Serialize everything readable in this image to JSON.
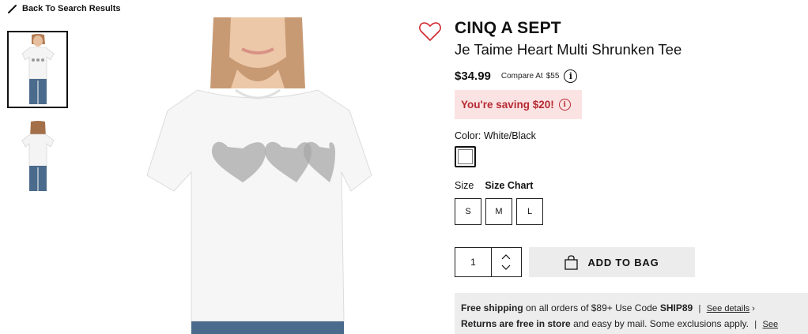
{
  "nav": {
    "back_label": "Back To Search Results"
  },
  "product": {
    "brand": "CINQ A SEPT",
    "name": "Je Taime Heart Multi Shrunken Tee",
    "price": "$34.99",
    "compare_label": "Compare At",
    "compare_value": "$55",
    "saving": "You're saving $20!"
  },
  "color": {
    "label": "Color:",
    "value": "White/Black"
  },
  "size": {
    "label": "Size",
    "chart_label": "Size Chart",
    "options": [
      "S",
      "M",
      "L"
    ]
  },
  "cart": {
    "quantity": "1",
    "add_label": "ADD TO BAG"
  },
  "shipping": {
    "line1_bold": "Free shipping",
    "line1_text": "on all orders of $89+ Use Code",
    "line1_code": "SHIP89",
    "line2_bold": "Returns are free in store",
    "line2_text": "and easy by mail. Some exclusions apply.",
    "details_label": "See details"
  },
  "colors": {
    "accent": "#d0282f",
    "saving_bg": "#fbe3e3",
    "saving_text": "#b52a32",
    "button_bg": "#ececec"
  },
  "icons": {
    "back": "pencil-icon",
    "wishlist": "heart-outline-icon",
    "info": "info-icon",
    "bag": "bag-icon"
  }
}
